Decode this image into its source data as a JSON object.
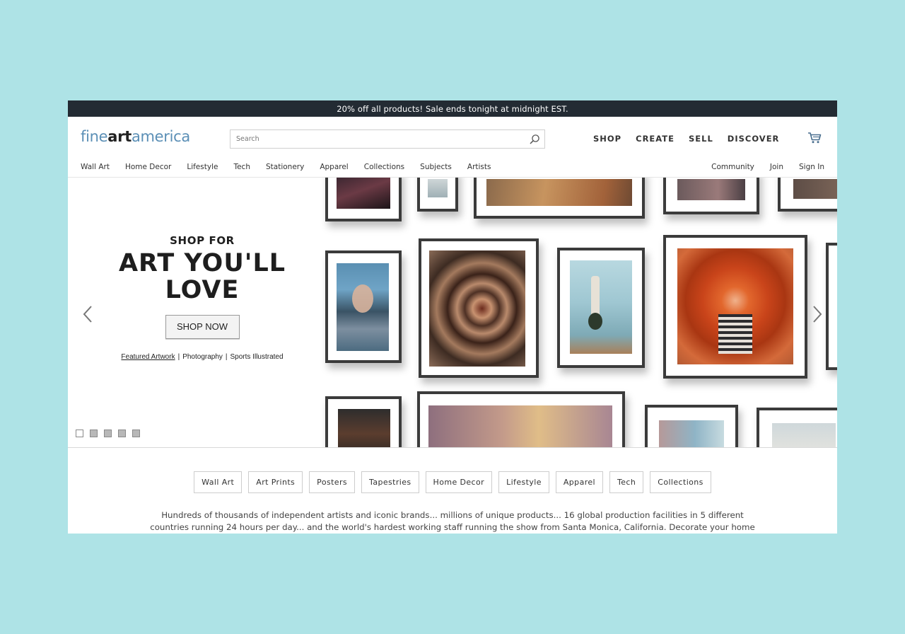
{
  "promo": {
    "text": "20% off all products!   Sale ends tonight at midnight EST."
  },
  "logo": {
    "part1": "fine",
    "part2": "art",
    "part3": "america"
  },
  "search": {
    "placeholder": "Search"
  },
  "main_nav": [
    "SHOP",
    "CREATE",
    "SELL",
    "DISCOVER"
  ],
  "subnav_left": [
    "Wall Art",
    "Home Decor",
    "Lifestyle",
    "Tech",
    "Stationery",
    "Apparel",
    "Collections",
    "Subjects",
    "Artists"
  ],
  "subnav_right": [
    "Community",
    "Join",
    "Sign In"
  ],
  "hero": {
    "kicker": "SHOP FOR",
    "title_line1": "ART YOU'LL",
    "title_line2": "LOVE",
    "button": "SHOP NOW",
    "links": [
      "Featured Artwork",
      "Photography",
      "Sports Illustrated"
    ],
    "slide_count": 5,
    "active_slide": 1
  },
  "categories": [
    "Wall Art",
    "Art Prints",
    "Posters",
    "Tapestries",
    "Home Decor",
    "Lifestyle",
    "Apparel",
    "Tech",
    "Collections"
  ],
  "blurb": "Hundreds of thousands of independent artists and iconic brands... millions of unique products... 16 global production facilities in 5 different countries running 24 hours per day... and the world's hardest working staff running the show from Santa Monica, California.   Decorate your home",
  "colors": {
    "promo_bg": "#232b33",
    "logo_blue": "#5b8fb6",
    "page_bg": "#aee3e6"
  },
  "icons": {
    "search": "magnifier-icon",
    "cart": "shopping-cart-icon",
    "prev": "chevron-left-icon",
    "next": "chevron-right-icon"
  }
}
